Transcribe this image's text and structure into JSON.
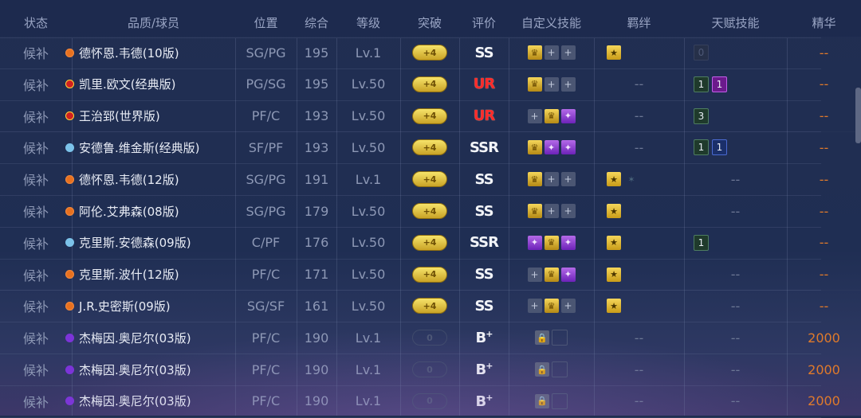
{
  "headers": {
    "status": "状态",
    "name": "品质/球员",
    "position": "位置",
    "overall": "综合",
    "level": "等级",
    "breakthrough": "突破",
    "rating": "评价",
    "custom_skills": "自定义技能",
    "bond": "羁绊",
    "talent": "天赋技能",
    "essence": "精华"
  },
  "rows": [
    {
      "status": "候补",
      "name": "德怀恩.韦德(10版)",
      "quality": "orange",
      "position": "SG/PG",
      "overall": "195",
      "level": "Lv.1",
      "breakthrough": "+4",
      "rating": "SS",
      "rating_sup": "",
      "rating_type": "normal",
      "skills": [
        "gold",
        "plus",
        "plus"
      ],
      "bond": [
        "gold"
      ],
      "talent": [
        {
          "v": "0",
          "c": "grey"
        }
      ],
      "essence": "--"
    },
    {
      "status": "候补",
      "name": "凯里.欧文(经典版)",
      "quality": "red",
      "position": "PG/SG",
      "overall": "195",
      "level": "Lv.50",
      "breakthrough": "+4",
      "rating": "UR",
      "rating_sup": "",
      "rating_type": "ur",
      "skills": [
        "gold",
        "plus",
        "plus"
      ],
      "bond": [],
      "talent": [
        {
          "v": "1",
          "c": "green"
        },
        {
          "v": "1",
          "c": "purple"
        }
      ],
      "essence": "--"
    },
    {
      "status": "候补",
      "name": "王治郅(世界版)",
      "quality": "red",
      "position": "PF/C",
      "overall": "193",
      "level": "Lv.50",
      "breakthrough": "+4",
      "rating": "UR",
      "rating_sup": "",
      "rating_type": "ur",
      "skills": [
        "plus",
        "gold",
        "purple"
      ],
      "bond": [],
      "talent": [
        {
          "v": "3",
          "c": "green"
        }
      ],
      "essence": "--"
    },
    {
      "status": "候补",
      "name": "安德鲁.维金斯(经典版)",
      "quality": "blue",
      "position": "SF/PF",
      "overall": "193",
      "level": "Lv.50",
      "breakthrough": "+4",
      "rating": "SSR",
      "rating_sup": "",
      "rating_type": "normal",
      "skills": [
        "gold",
        "purple",
        "purple"
      ],
      "bond": [],
      "talent": [
        {
          "v": "1",
          "c": "green"
        },
        {
          "v": "1",
          "c": "blue"
        }
      ],
      "essence": "--"
    },
    {
      "status": "候补",
      "name": "德怀恩.韦德(12版)",
      "quality": "orange",
      "position": "SG/PG",
      "overall": "191",
      "level": "Lv.1",
      "breakthrough": "+4",
      "rating": "SS",
      "rating_sup": "",
      "rating_type": "normal",
      "skills": [
        "gold",
        "plus",
        "plus"
      ],
      "bond": [
        "gold",
        "dim"
      ],
      "talent": [],
      "essence": "--"
    },
    {
      "status": "候补",
      "name": "阿伦.艾弗森(08版)",
      "quality": "orange",
      "position": "SG/PG",
      "overall": "179",
      "level": "Lv.50",
      "breakthrough": "+4",
      "rating": "SS",
      "rating_sup": "",
      "rating_type": "normal",
      "skills": [
        "gold",
        "plus",
        "plus"
      ],
      "bond": [
        "gold"
      ],
      "talent": [],
      "essence": "--"
    },
    {
      "status": "候补",
      "name": "克里斯.安德森(09版)",
      "quality": "blue",
      "position": "C/PF",
      "overall": "176",
      "level": "Lv.50",
      "breakthrough": "+4",
      "rating": "SSR",
      "rating_sup": "",
      "rating_type": "normal",
      "skills": [
        "purple",
        "gold",
        "purple"
      ],
      "bond": [
        "gold"
      ],
      "talent": [
        {
          "v": "1",
          "c": "green"
        }
      ],
      "essence": "--"
    },
    {
      "status": "候补",
      "name": "克里斯.波什(12版)",
      "quality": "orange",
      "position": "PF/C",
      "overall": "171",
      "level": "Lv.50",
      "breakthrough": "+4",
      "rating": "SS",
      "rating_sup": "",
      "rating_type": "normal",
      "skills": [
        "plus",
        "gold",
        "purple"
      ],
      "bond": [
        "gold"
      ],
      "talent": [],
      "essence": "--"
    },
    {
      "status": "候补",
      "name": "J.R.史密斯(09版)",
      "quality": "orange",
      "position": "SG/SF",
      "overall": "161",
      "level": "Lv.50",
      "breakthrough": "+4",
      "rating": "SS",
      "rating_sup": "",
      "rating_type": "normal",
      "skills": [
        "plus",
        "gold",
        "plus"
      ],
      "bond": [
        "gold"
      ],
      "talent": [],
      "essence": "--"
    },
    {
      "status": "候补",
      "name": "杰梅因.奥尼尔(03版)",
      "quality": "purple",
      "position": "PF/C",
      "overall": "190",
      "level": "Lv.1",
      "breakthrough": "0",
      "rating": "B",
      "rating_sup": "+",
      "rating_type": "normal",
      "skills": [
        "lock",
        "emptybox"
      ],
      "bond": [],
      "talent": [],
      "essence": "2000"
    },
    {
      "status": "候补",
      "name": "杰梅因.奥尼尔(03版)",
      "quality": "purple",
      "position": "PF/C",
      "overall": "190",
      "level": "Lv.1",
      "breakthrough": "0",
      "rating": "B",
      "rating_sup": "+",
      "rating_type": "normal",
      "skills": [
        "lock",
        "emptybox"
      ],
      "bond": [],
      "talent": [],
      "essence": "2000"
    },
    {
      "status": "候补",
      "name": "杰梅因.奥尼尔(03版)",
      "quality": "purple",
      "position": "PF/C",
      "overall": "190",
      "level": "Lv.1",
      "breakthrough": "0",
      "rating": "B",
      "rating_sup": "+",
      "rating_type": "normal",
      "skills": [
        "lock",
        "emptybox"
      ],
      "bond": [],
      "talent": [],
      "essence": "2000"
    }
  ],
  "empty_marker": "--",
  "colors": {
    "essence": "#e07a2a",
    "ur": "#ff2a2a",
    "gold": "#f5d65a"
  }
}
